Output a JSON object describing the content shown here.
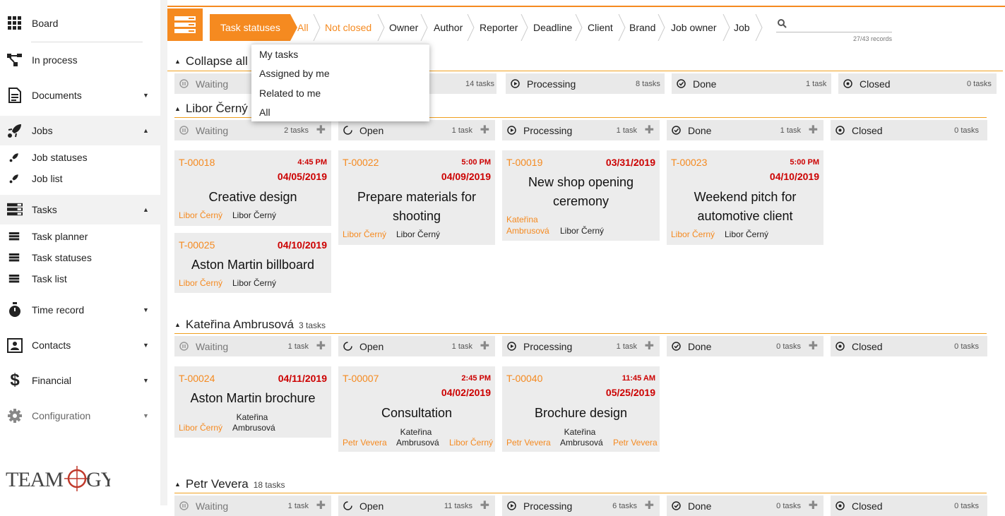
{
  "sidebar": {
    "items": [
      {
        "label": "Board",
        "icon": "grid-icon"
      },
      {
        "label": "In process",
        "icon": "flow-icon"
      },
      {
        "label": "Documents",
        "icon": "document-icon"
      },
      {
        "label": "Jobs",
        "icon": "rocket-icon"
      },
      {
        "label": "Job statuses",
        "icon": "rocket-icon"
      },
      {
        "label": "Job list",
        "icon": "rocket-icon"
      },
      {
        "label": "Tasks",
        "icon": "tasks-icon"
      },
      {
        "label": "Task planner",
        "icon": "tasks-icon"
      },
      {
        "label": "Task statuses",
        "icon": "tasks-icon"
      },
      {
        "label": "Task list",
        "icon": "tasks-icon"
      },
      {
        "label": "Time record",
        "icon": "stopwatch-icon"
      },
      {
        "label": "Contacts",
        "icon": "contact-card-icon"
      },
      {
        "label": "Financial",
        "icon": "dollar-icon"
      },
      {
        "label": "Configuration",
        "icon": "gear-icon"
      }
    ],
    "logo_text": "TEAMOGY"
  },
  "toolbar": {
    "active": "Task statuses",
    "filters": [
      "All",
      "Not closed",
      "Owner",
      "Author",
      "Reporter",
      "Deadline",
      "Client",
      "Brand",
      "Job owner",
      "Job"
    ],
    "records": "27/43 records",
    "search_placeholder": ""
  },
  "dropdown": {
    "items": [
      "My tasks",
      "Assigned by me",
      "Related to me",
      "All"
    ]
  },
  "collapse_label": "Collapse all",
  "summary": {
    "waiting": "Waiting",
    "open_count": "14 tasks",
    "processing": "Processing",
    "processing_count": "8 tasks",
    "done": "Done",
    "done_count": "1 task",
    "closed": "Closed",
    "closed_count": "0 tasks"
  },
  "groups": [
    {
      "name": "Libor Černý",
      "count": "",
      "columns": [
        {
          "label": "Waiting",
          "count": "2 tasks"
        },
        {
          "label": "Open",
          "count": "1 task"
        },
        {
          "label": "Processing",
          "count": "1 task"
        },
        {
          "label": "Done",
          "count": "1 task"
        },
        {
          "label": "Closed",
          "count": "0 tasks"
        }
      ],
      "cards": [
        {
          "id": "T-00018",
          "time": "4:45 PM",
          "date": "04/05/2019",
          "title": "Creative design",
          "p1": "Libor Černý",
          "p2": "Libor Černý"
        },
        {
          "id": "T-00025",
          "time": "",
          "date": "04/10/2019",
          "title": "Aston Martin billboard",
          "p1": "Libor Černý",
          "p2": "Libor Černý"
        },
        {
          "id": "T-00022",
          "time": "5:00 PM",
          "date": "04/09/2019",
          "title1": "Prepare materials for",
          "title2": "shooting",
          "p1": "Libor Černý",
          "p2": "Libor Černý"
        },
        {
          "id": "T-00019",
          "time": "",
          "date": "03/31/2019",
          "title1": "New shop opening",
          "title2": "ceremony",
          "p1a": "Kateřina",
          "p1b": "Ambrusová",
          "p2": "Libor Černý"
        },
        {
          "id": "T-00023",
          "time": "5:00 PM",
          "date": "04/10/2019",
          "title1": "Weekend pitch for",
          "title2": "automotive client",
          "p1": "Libor Černý",
          "p2": "Libor Černý"
        }
      ]
    },
    {
      "name": "Kateřina Ambrusová",
      "count": "3 tasks",
      "columns": [
        {
          "label": "Waiting",
          "count": "1 task"
        },
        {
          "label": "Open",
          "count": "1 task"
        },
        {
          "label": "Processing",
          "count": "1 task"
        },
        {
          "label": "Done",
          "count": "0 tasks"
        },
        {
          "label": "Closed",
          "count": "0 tasks"
        }
      ],
      "cards": [
        {
          "id": "T-00024",
          "date": "04/11/2019",
          "title": "Aston Martin brochure",
          "p1": "Libor Černý",
          "p2a": "Kateřina",
          "p2b": "Ambrusová"
        },
        {
          "id": "T-00007",
          "time": "2:45 PM",
          "date": "04/02/2019",
          "title": "Consultation",
          "p1": "Petr Vevera",
          "p2a": "Kateřina",
          "p2b": "Ambrusová",
          "p3": "Libor Černý"
        },
        {
          "id": "T-00040",
          "time": "11:45 AM",
          "date": "05/25/2019",
          "title": "Brochure design",
          "p1": "Petr Vevera",
          "p2a": "Kateřina",
          "p2b": "Ambrusová",
          "p3": "Petr Vevera"
        }
      ]
    },
    {
      "name": "Petr Vevera",
      "count": "18 tasks",
      "columns": [
        {
          "label": "Waiting",
          "count": "1 task"
        },
        {
          "label": "Open",
          "count": "11 tasks"
        },
        {
          "label": "Processing",
          "count": "6 tasks"
        },
        {
          "label": "Done",
          "count": "0 tasks"
        },
        {
          "label": "Closed",
          "count": "0 tasks"
        }
      ]
    }
  ]
}
